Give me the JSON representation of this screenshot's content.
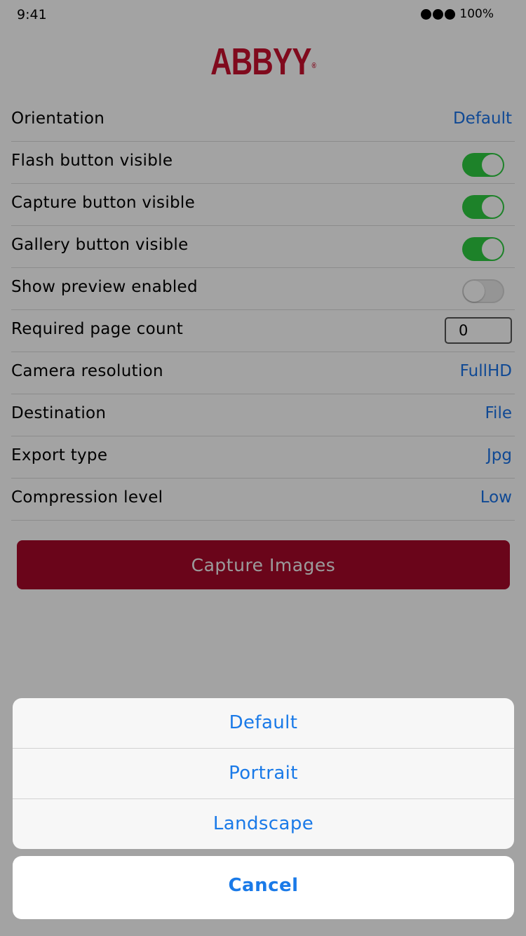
{
  "status_bar": {
    "time": "9:41",
    "battery": "100%"
  },
  "logo": {
    "text": "ABBYY",
    "registered": "®"
  },
  "settings": {
    "orientation": {
      "label": "Orientation",
      "value": "Default"
    },
    "flash_button": {
      "label": "Flash button visible",
      "enabled": true
    },
    "capture_button": {
      "label": "Capture button visible",
      "enabled": true
    },
    "gallery_button": {
      "label": "Gallery button visible",
      "enabled": true
    },
    "show_preview": {
      "label": "Show preview enabled",
      "enabled": false
    },
    "page_count": {
      "label": "Required page count",
      "value": "0"
    },
    "camera_resolution": {
      "label": "Camera resolution",
      "value": "FullHD"
    },
    "destination": {
      "label": "Destination",
      "value": "File"
    },
    "export_type": {
      "label": "Export type",
      "value": "Jpg"
    },
    "compression": {
      "label": "Compression level",
      "value": "Low"
    }
  },
  "capture_button_label": "Capture Images",
  "action_sheet": {
    "options": [
      "Default",
      "Portrait",
      "Landscape"
    ],
    "cancel": "Cancel"
  },
  "colors": {
    "brand": "#c8102e",
    "button": "#a6082a",
    "link": "#1a73e8",
    "toggle_on": "#2ecc40"
  }
}
